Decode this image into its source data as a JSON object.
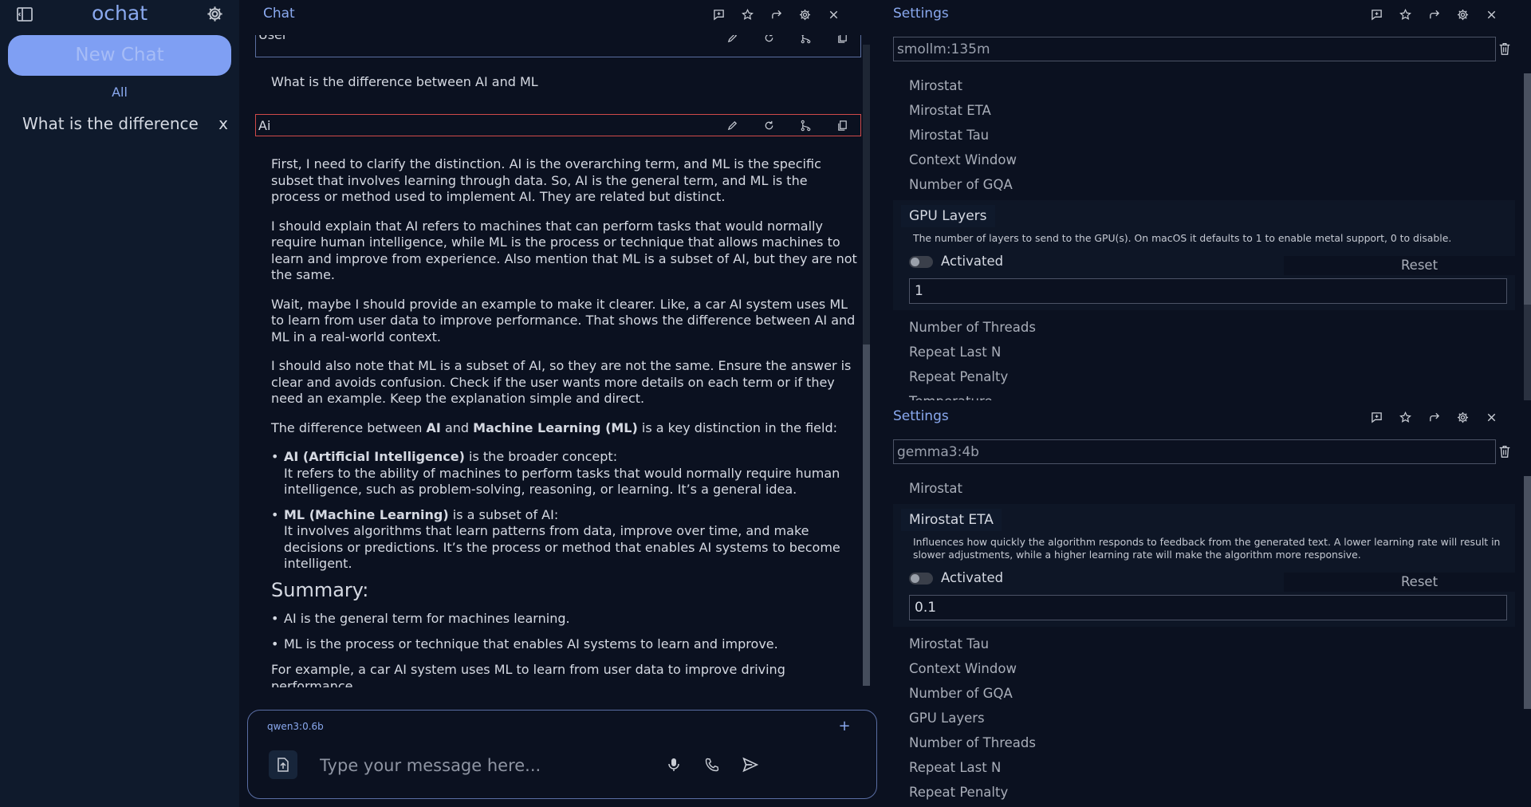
{
  "sidebar": {
    "app_title": "ochat",
    "new_chat_label": "New Chat",
    "filter_label": "All",
    "chats": [
      {
        "title": "What is the difference",
        "close": "x"
      }
    ]
  },
  "chat": {
    "title": "Chat",
    "user_role": "User",
    "user_message": "What is the difference between AI and ML",
    "ai_role": "Ai",
    "ai_paragraphs": [
      "First, I need to clarify the distinction. AI is the overarching term, and ML is the specific subset that involves learning through data. So, AI is the general term, and ML is the process or method used to implement AI. They are related but distinct.",
      "I should explain that AI refers to machines that can perform tasks that would normally require human intelligence, while ML is the process or technique that allows machines to learn and improve from experience. Also mention that ML is a subset of AI, but they are not the same.",
      "Wait, maybe I should provide an example to make it clearer. Like, a car AI system uses ML to learn from user data to improve performance. That shows the difference between AI and ML in a real-world context.",
      "I should also note that ML is a subset of AI, so they are not the same. Ensure the answer is clear and avoids confusion. Check if the user wants more details on each term or if they need an example. Keep the explanation simple and direct."
    ],
    "intro": {
      "before": "The difference between ",
      "ai_bold": "AI",
      "mid": " and ",
      "ml_bold": "Machine Learning (ML)",
      "after": " is a key distinction in the field:"
    },
    "bullets": [
      {
        "head": "AI (Artificial Intelligence)",
        "tail": " is the broader concept:",
        "detail": "It refers to the ability of machines to perform tasks that would normally require human intelligence, such as problem-solving, reasoning, or learning. It’s a general idea."
      },
      {
        "head": "ML (Machine Learning)",
        "tail": " is a subset of AI:",
        "detail": "It involves algorithms that learn patterns from data, improve over time, and make decisions or predictions. It’s the process or method that enables AI systems to become intelligent."
      }
    ],
    "summary_heading": "Summary:",
    "summary_items": [
      "AI is the general term for machines learning.",
      "ML is the process or technique that enables AI systems to learn and improve."
    ],
    "closing": "For example, a car AI system uses ML to learn from user data to improve driving performance."
  },
  "composer": {
    "model": "qwen3:0.6b",
    "add": "+",
    "placeholder": "Type your message here..."
  },
  "settings_1": {
    "title": "Settings",
    "model": "smollm:135m",
    "params_before": [
      "Mirostat",
      "Mirostat ETA",
      "Mirostat Tau",
      "Context Window",
      "Number of GQA"
    ],
    "expanded": {
      "name": "GPU Layers",
      "description": "The number of layers to send to the GPU(s). On macOS it defaults to 1 to enable metal support, 0 to disable.",
      "toggle_label": "Activated",
      "reset_label": "Reset",
      "value": "1"
    },
    "params_after": [
      "Number of Threads",
      "Repeat Last N",
      "Repeat Penalty",
      "Temperature"
    ]
  },
  "settings_2": {
    "title": "Settings",
    "model": "gemma3:4b",
    "params_before": [
      "Mirostat"
    ],
    "expanded": {
      "name": "Mirostat ETA",
      "description": "Influences how quickly the algorithm responds to feedback from the generated text. A lower learning rate will result in slower adjustments, while a higher learning rate will make the algorithm more responsive.",
      "toggle_label": "Activated",
      "reset_label": "Reset",
      "value": "0.1"
    },
    "params_after": [
      "Mirostat Tau",
      "Context Window",
      "Number of GQA",
      "GPU Layers",
      "Number of Threads",
      "Repeat Last N",
      "Repeat Penalty"
    ]
  },
  "colors": {
    "accent": "#8aa9ef",
    "new_chat_bg": "#7f9ff3",
    "ai_border": "#d04a4a",
    "background": "#0b1120",
    "sidebar_bg": "#0f1a2c"
  },
  "icons": {
    "sidebar_toggle": "sidebar-toggle-icon",
    "settings": "gear-icon",
    "header": [
      "add-comment-icon",
      "star-icon",
      "share-icon",
      "gear-icon",
      "close-icon"
    ],
    "message_tools": [
      "edit-icon",
      "regenerate-icon",
      "branch-icon",
      "copy-icon"
    ],
    "composer": [
      "upload-icon",
      "mic-icon",
      "phone-icon",
      "send-icon"
    ],
    "delete": "trash-icon"
  }
}
